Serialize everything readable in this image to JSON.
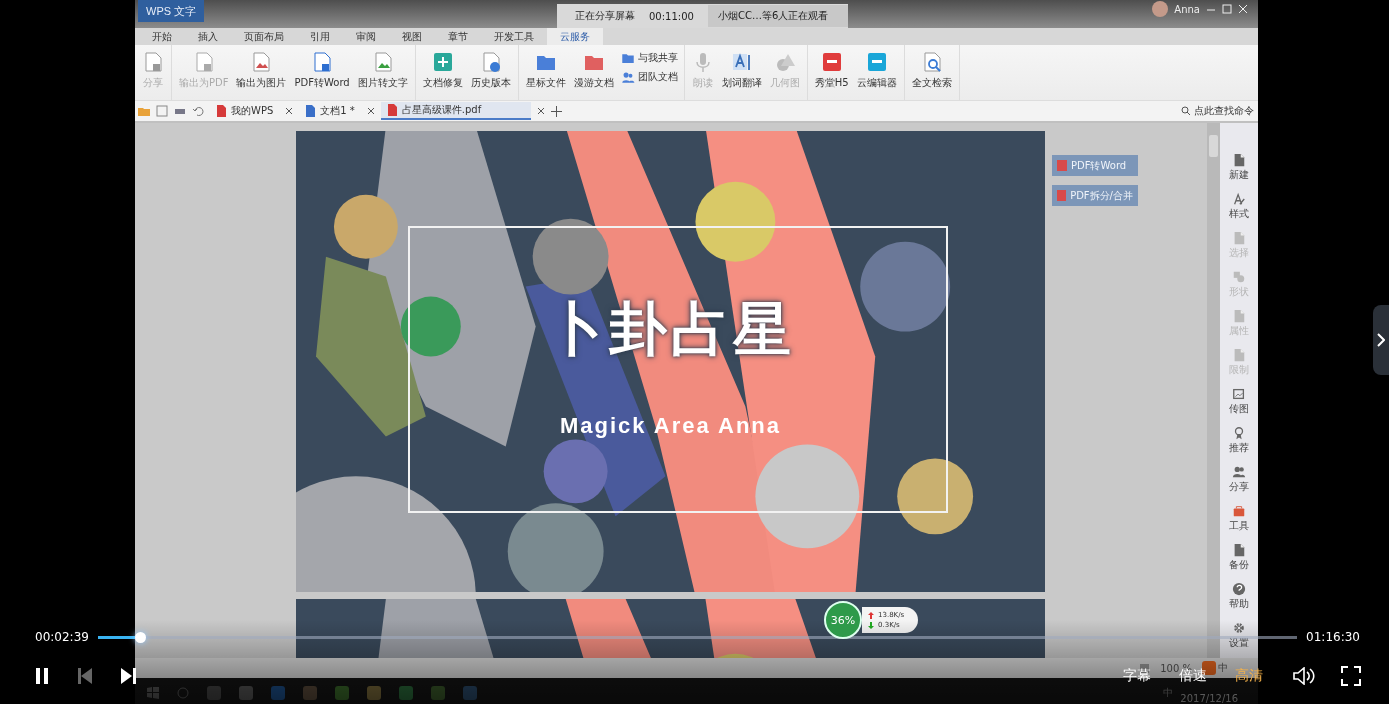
{
  "wps": {
    "app_button": "WPS 文字",
    "share_banner": {
      "status": "正在分享屏幕",
      "time": "00:11:00",
      "viewers": "小烟CC…等6人正在观看"
    },
    "user": "Anna",
    "menu_tabs": [
      {
        "label": "开始",
        "selected": false
      },
      {
        "label": "插入",
        "selected": false
      },
      {
        "label": "页面布局",
        "selected": false
      },
      {
        "label": "引用",
        "selected": false
      },
      {
        "label": "审阅",
        "selected": false
      },
      {
        "label": "视图",
        "selected": false
      },
      {
        "label": "章节",
        "selected": false
      },
      {
        "label": "开发工具",
        "selected": false
      },
      {
        "label": "云服务",
        "selected": true
      }
    ],
    "ribbon": [
      [
        {
          "label": "分享",
          "kind": "large",
          "disabled": true
        }
      ],
      [
        {
          "label": "输出为PDF",
          "kind": "large",
          "disabled": true
        },
        {
          "label": "输出为图片",
          "kind": "large",
          "disabled": false
        },
        {
          "label": "PDF转Word",
          "kind": "large",
          "disabled": false
        },
        {
          "label": "图片转文字",
          "kind": "large",
          "disabled": false
        }
      ],
      [
        {
          "label": "文档修复",
          "kind": "large",
          "disabled": false
        },
        {
          "label": "历史版本",
          "kind": "large",
          "disabled": false
        }
      ],
      [
        {
          "label": "星标文件",
          "kind": "large",
          "disabled": false
        },
        {
          "label": "漫游文档",
          "kind": "large",
          "disabled": false
        },
        {
          "label": "与我共享",
          "kind": "small",
          "disabled": false
        },
        {
          "label": "团队文档",
          "kind": "small",
          "disabled": false
        }
      ],
      [
        {
          "label": "朗读",
          "kind": "large",
          "disabled": true
        },
        {
          "label": "划词翻译",
          "kind": "large",
          "disabled": false
        },
        {
          "label": "几何图",
          "kind": "large",
          "disabled": true
        }
      ],
      [
        {
          "label": "秀堂H5",
          "kind": "large",
          "disabled": false
        },
        {
          "label": "云编辑器",
          "kind": "large",
          "disabled": false
        }
      ],
      [
        {
          "label": "全文检索",
          "kind": "large",
          "disabled": false
        }
      ]
    ],
    "doc_tabs": [
      {
        "label": "我的WPS",
        "selected": false
      },
      {
        "label": "文档1 *",
        "selected": false
      },
      {
        "label": "占星高级课件.pdf",
        "selected": true
      }
    ],
    "command_search": "点此查找命令",
    "document": {
      "title": "卜卦占星",
      "subtitle": "Magick Area Anna"
    },
    "pdf_actions": [
      "PDF转Word",
      "PDF拆分/合并"
    ],
    "sidebar": [
      {
        "label": "新建",
        "disabled": false
      },
      {
        "label": "样式",
        "disabled": false
      },
      {
        "label": "选择",
        "disabled": true
      },
      {
        "label": "形状",
        "disabled": true
      },
      {
        "label": "属性",
        "disabled": true
      },
      {
        "label": "限制",
        "disabled": true
      },
      {
        "label": "传图",
        "disabled": false
      },
      {
        "label": "推荐",
        "disabled": false
      },
      {
        "label": "分享",
        "disabled": false
      },
      {
        "label": "工具",
        "disabled": false
      },
      {
        "label": "备份",
        "disabled": false
      },
      {
        "label": "帮助",
        "disabled": false
      },
      {
        "label": "设置",
        "disabled": false
      }
    ],
    "network": {
      "percent": "36%",
      "upload": "13.8K/s",
      "download": "0.3K/s"
    },
    "status_bar": {
      "zoom": "100 %",
      "ime": "中"
    },
    "taskbar": {
      "ime": "中",
      "date": "2017/12/16"
    }
  },
  "player": {
    "elapsed": "00:02:39",
    "duration": "01:16:30",
    "progress": {
      "level": 0.035
    },
    "buttons": [
      {
        "kind": "pause",
        "disabled": false
      },
      {
        "kind": "previous",
        "disabled": true
      },
      {
        "kind": "next",
        "disabled": false
      }
    ],
    "options": [
      {
        "label": "字幕",
        "selected": false
      },
      {
        "label": "倍速",
        "selected": false
      },
      {
        "label": "高清",
        "selected": true
      }
    ]
  }
}
